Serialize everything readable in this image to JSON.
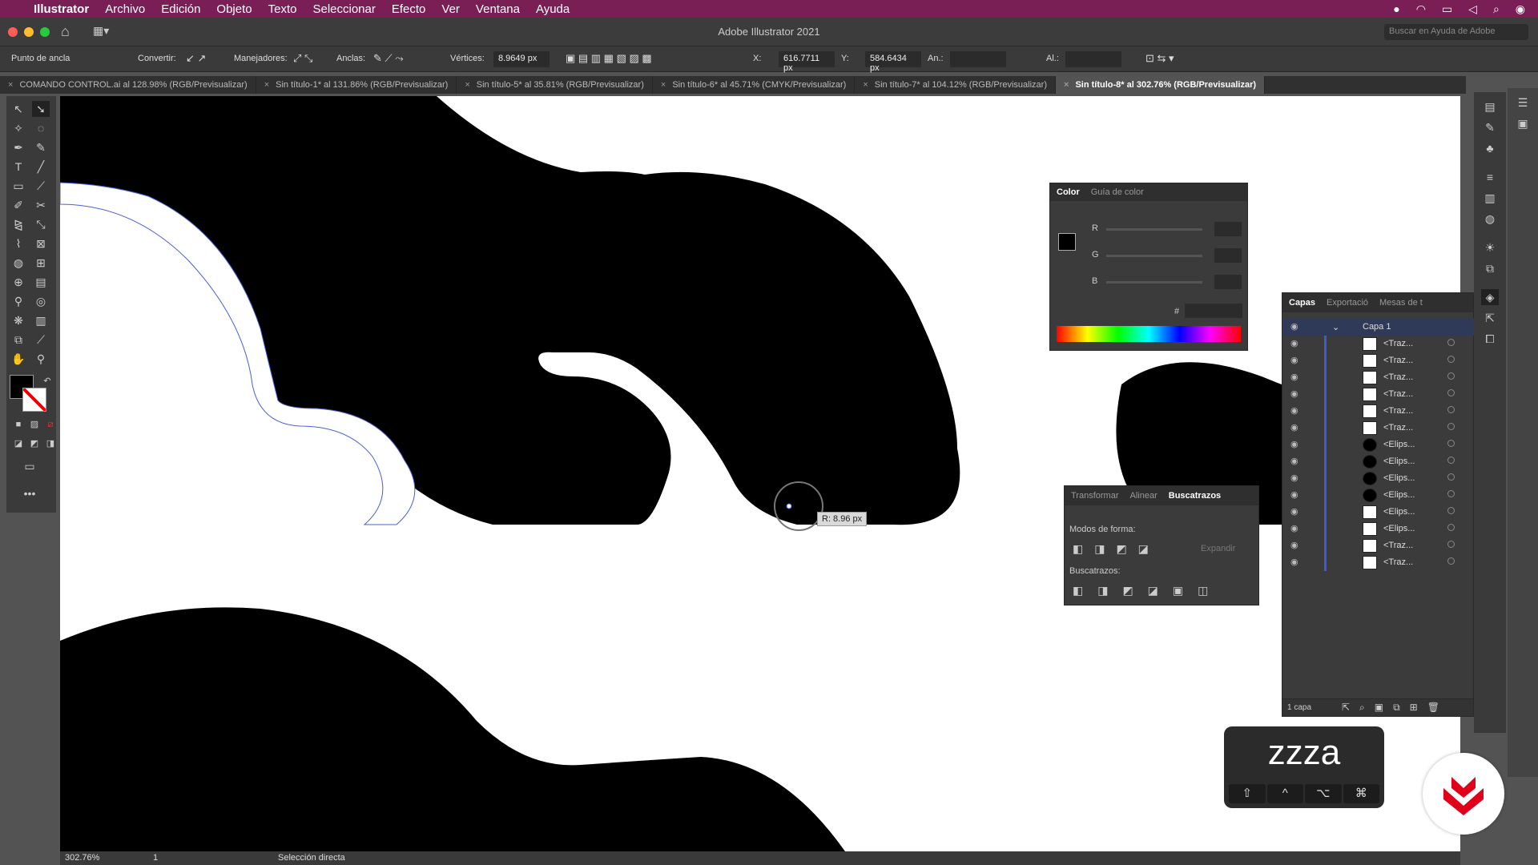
{
  "menubar": {
    "app": "Illustrator",
    "items": [
      "Archivo",
      "Edición",
      "Objeto",
      "Texto",
      "Seleccionar",
      "Efecto",
      "Ver",
      "Ventana",
      "Ayuda"
    ]
  },
  "window": {
    "title": "Adobe Illustrator 2021",
    "help_placeholder": "Buscar en Ayuda de Adobe"
  },
  "control": {
    "mode": "Punto de ancla",
    "convert": "Convertir:",
    "handles": "Manejadores:",
    "anchors": "Anclas:",
    "vertices_label": "Vértices:",
    "vertices": "8.9649 px",
    "x_label": "X:",
    "x": "616.7711 px",
    "y_label": "Y:",
    "y": "584.6434 px",
    "w_label": "An.:",
    "h_label": "Al.:"
  },
  "tabs": [
    "COMANDO CONTROL.ai al 128.98% (RGB/Previsualizar)",
    "Sin título-1* al 131.86% (RGB/Previsualizar)",
    "Sin título-5* al 35.81% (RGB/Previsualizar)",
    "Sin título-6* al 45.71% (CMYK/Previsualizar)",
    "Sin título-7* al 104.12% (RGB/Previsualizar)",
    "Sin título-8* al 302.76% (RGB/Previsualizar)"
  ],
  "tooltip": "R: 8.96 px",
  "color_panel": {
    "tabs": [
      "Color",
      "Guía de color"
    ],
    "r": "R",
    "g": "G",
    "b": "B",
    "hash": "#"
  },
  "pathfinder": {
    "tabs": [
      "Transformar",
      "Alinear",
      "Buscatrazos"
    ],
    "shape_modes": "Modos de forma:",
    "expand": "Expandir",
    "pathfinders": "Buscatrazos:"
  },
  "layers": {
    "tabs": [
      "Capas",
      "Exportació",
      "Mesas de t"
    ],
    "layer": "Capa 1",
    "items": [
      "<Traz...",
      "<Traz...",
      "<Traz...",
      "<Traz...",
      "<Traz...",
      "<Traz...",
      "<Elips...",
      "<Elips...",
      "<Elips...",
      "<Elips...",
      "<Elips...",
      "<Elips...",
      "<Traz...",
      "<Traz..."
    ],
    "footer": "1 capa"
  },
  "status": {
    "zoom": "302.76%",
    "artboard": "1",
    "tool": "Selección directa"
  },
  "keycast": {
    "text": "zzza",
    "keys": [
      "⇧",
      "^",
      "⌥",
      "⌘"
    ]
  },
  "colors": {
    "menubar": "#7a1f55",
    "accent": "#3b5bd9",
    "logo": "#e1001a"
  }
}
